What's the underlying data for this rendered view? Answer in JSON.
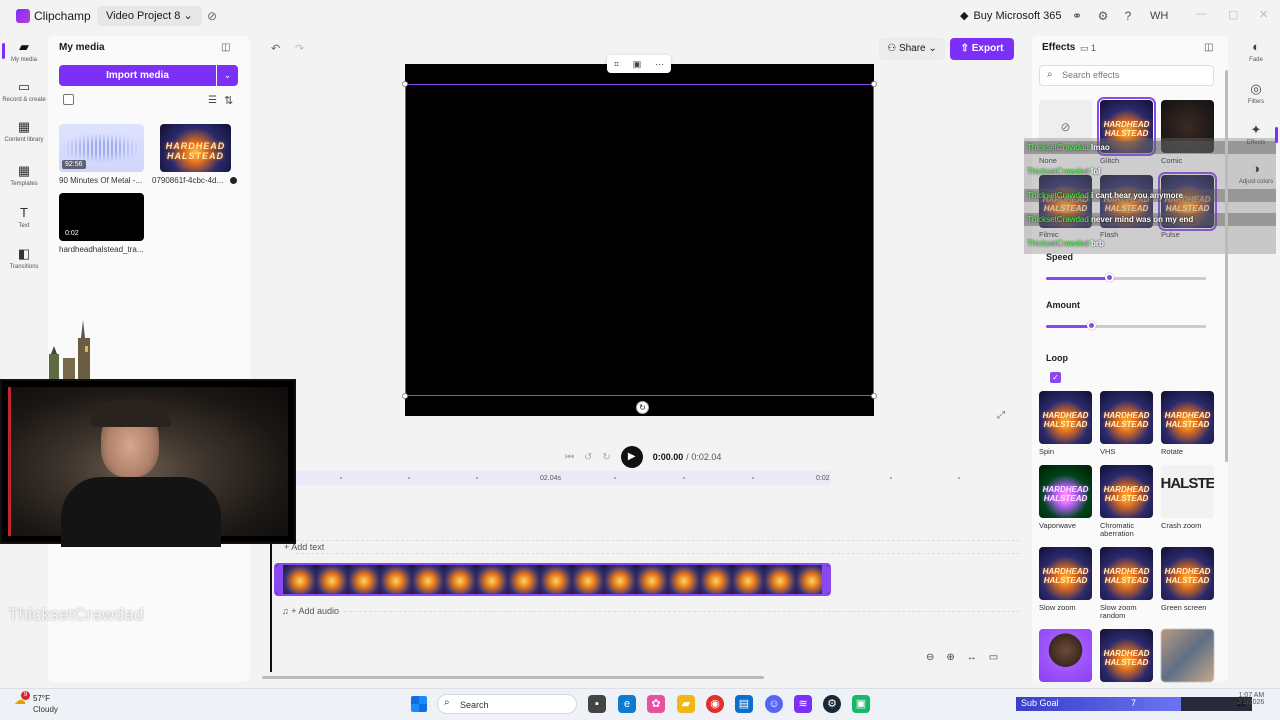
{
  "titlebar": {
    "app_name": "Clipchamp",
    "project_name": "Video Project 8",
    "project_caret": "⌄",
    "buy_label": "Buy Microsoft 365",
    "avatar_initials": "WH"
  },
  "left_nav": [
    {
      "label": "My media",
      "icon": "folder-icon"
    },
    {
      "label": "Record & create",
      "icon": "camera-icon"
    },
    {
      "label": "Content library",
      "icon": "library-icon"
    },
    {
      "label": "Templates",
      "icon": "templates-icon"
    },
    {
      "label": "Text",
      "icon": "text-icon"
    },
    {
      "label": "Transitions",
      "icon": "transitions-icon"
    }
  ],
  "media": {
    "title": "My media",
    "import_label": "Import media",
    "items": [
      {
        "caption": "90 Minutes Of Metal -...",
        "duration": "92:56",
        "kind": "audio"
      },
      {
        "caption": "0790861f-4cbc-4d...",
        "duration": "",
        "kind": "art"
      },
      {
        "caption": "hardheadhalstead_tra...",
        "duration": "0:02",
        "kind": "black"
      }
    ],
    "art_text": "HARDHEAD HALSTEAD"
  },
  "webcam": {
    "overlay_name": "ThicksetCrawdad"
  },
  "toolbar": {
    "share_label": "Share",
    "export_label": "Export"
  },
  "playback": {
    "current": "0:00.00",
    "separator": "/",
    "total": "0:02.04"
  },
  "timeline": {
    "marker_label": "02.04s",
    "end_label": "0:02",
    "add_text_label": "+ Add text",
    "add_audio_label": "+ Add audio"
  },
  "effects": {
    "title": "Effects",
    "count": "1",
    "search_placeholder": "Search effects",
    "grid": [
      {
        "label": "None",
        "kind": "none"
      },
      {
        "label": "Glitch",
        "kind": "art",
        "selected": true
      },
      {
        "label": "Comic",
        "kind": "dark"
      },
      {
        "label": "Filmic",
        "kind": "art"
      },
      {
        "label": "Flash",
        "kind": "art"
      },
      {
        "label": "Pulse",
        "kind": "art",
        "selected": true
      }
    ],
    "speed_label": "Speed",
    "speed_value": 0.4,
    "amount_label": "Amount",
    "amount_value": 0.29,
    "loop_label": "Loop",
    "loop_checked": true,
    "more": [
      {
        "label": "Spin",
        "kind": "art"
      },
      {
        "label": "VHS",
        "kind": "art"
      },
      {
        "label": "Rotate",
        "kind": "art"
      },
      {
        "label": "Vaporwave",
        "kind": "art"
      },
      {
        "label": "Chromatic aberration",
        "kind": "art"
      },
      {
        "label": "Crash zoom",
        "kind": "crash"
      },
      {
        "label": "Slow zoom",
        "kind": "art"
      },
      {
        "label": "Slow zoom random",
        "kind": "art"
      },
      {
        "label": "Green screen",
        "kind": "art"
      },
      {
        "label": "",
        "kind": "face"
      },
      {
        "label": "",
        "kind": "art"
      },
      {
        "label": "",
        "kind": "blur"
      }
    ],
    "crash_text": "HALSTE"
  },
  "chat": [
    {
      "user": "ThicksetCrawdad",
      "msg": "lmao"
    },
    {
      "user": "ThicksetCrawdad",
      "msg": "lol"
    },
    {
      "user": "ThicksetCrawdad",
      "msg": "i cant hear you anymore"
    },
    {
      "user": "ThicksetCrawdad",
      "msg": "never mind was on my end"
    },
    {
      "user": "ThicksetCrawdad",
      "msg": "brb"
    }
  ],
  "right_rail": [
    {
      "label": "Fade",
      "icon": "fade-icon"
    },
    {
      "label": "Filters",
      "icon": "filters-icon"
    },
    {
      "label": "Effects",
      "icon": "effects-wand-icon"
    },
    {
      "label": "Adjust colors",
      "icon": "adjust-colors-icon"
    }
  ],
  "taskbar": {
    "temp": "57°F",
    "weather": "Cloudy",
    "weather_badge": "9",
    "search_label": "Search",
    "subgoal_label": "Sub Goal",
    "subgoal_current": "7",
    "subgoal_max": "10",
    "clock_time": "1:07 AM",
    "clock_date": "2/1/2026"
  },
  "colors": {
    "accent": "#7b2ff7",
    "selection": "#8a48f0"
  }
}
